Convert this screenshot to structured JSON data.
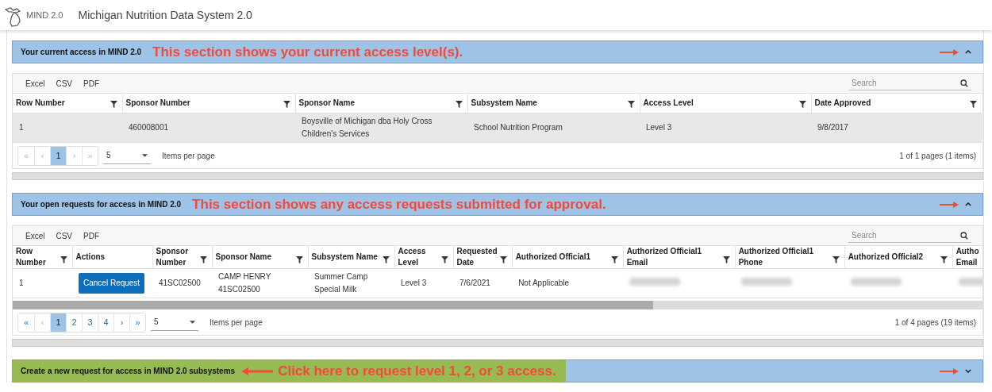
{
  "app": {
    "logo_text": "MIND 2.0",
    "title": "Michigan Nutrition Data System 2.0"
  },
  "panels": [
    {
      "kind": "grid",
      "title": "Your current access in MIND 2.0",
      "annotation": "This section shows your current access level(s).",
      "highlighted": false,
      "expanded": true,
      "grid": {
        "toolbar": [
          "Excel",
          "CSV",
          "PDF"
        ],
        "search": {
          "placeholder": "Search"
        },
        "scrollable": false,
        "columns": [
          {
            "label": "Row Number"
          },
          {
            "label": "Sponsor Number"
          },
          {
            "label": "Sponsor Name"
          },
          {
            "label": "Subsystem Name"
          },
          {
            "label": "Access Level"
          },
          {
            "label": "Date Approved"
          }
        ],
        "rows": [
          {
            "selected": true,
            "cells": [
              {
                "kind": "text",
                "text": "1"
              },
              {
                "kind": "text",
                "text": "460008001"
              },
              {
                "kind": "text",
                "text": "Boysville of Michigan dba Holy Cross Children's Services"
              },
              {
                "kind": "text",
                "text": "School Nutrition Program"
              },
              {
                "kind": "text",
                "text": "Level 3"
              },
              {
                "kind": "text",
                "text": "9/8/2017"
              }
            ]
          }
        ],
        "pager": {
          "first": "«",
          "prev": "‹",
          "next": "›",
          "last": "»",
          "nav_enabled": false,
          "pages": [
            {
              "label": "1",
              "selected": true
            }
          ],
          "page_size": "5",
          "page_size_label": "Items per page",
          "summary": "1 of 1 pages (1 items)"
        }
      }
    },
    {
      "kind": "grid",
      "title": "Your open requests for access in MIND 2.0",
      "annotation": "This section shows any access requests submitted for approval.",
      "highlighted": false,
      "expanded": true,
      "grid": {
        "toolbar": [
          "Excel",
          "CSV",
          "PDF"
        ],
        "search": {
          "placeholder": "Search"
        },
        "scrollable": true,
        "columns": [
          {
            "label": "Row Number",
            "filter": true
          },
          {
            "label": "Actions",
            "filter": false
          },
          {
            "label": "Sponsor Number",
            "filter": true
          },
          {
            "label": "Sponsor Name",
            "filter": true
          },
          {
            "label": "Subsystem Name",
            "filter": true
          },
          {
            "label": "Access Level",
            "filter": true
          },
          {
            "label": "Requested Date",
            "filter": true
          },
          {
            "label": "Authorized Official1",
            "filter": true
          },
          {
            "label": "Authorized Official1 Email",
            "filter": true
          },
          {
            "label": "Authorized Official1 Phone",
            "filter": true
          },
          {
            "label": "Authorized Official2",
            "filter": true
          },
          {
            "label": "Autho Email",
            "filter": false
          }
        ],
        "rows": [
          {
            "selected": false,
            "cells": [
              {
                "kind": "text",
                "text": "1"
              },
              {
                "kind": "button",
                "text": "Cancel Request"
              },
              {
                "kind": "text",
                "text": "41SC02500"
              },
              {
                "kind": "text",
                "text": "CAMP HENRY 41SC02500"
              },
              {
                "kind": "text",
                "text": "Summer Camp Special Milk"
              },
              {
                "kind": "text",
                "text": "Level 3"
              },
              {
                "kind": "text",
                "text": "7/6/2021"
              },
              {
                "kind": "text",
                "text": "Not Applicable"
              },
              {
                "kind": "redacted"
              },
              {
                "kind": "redacted"
              },
              {
                "kind": "redacted"
              },
              {
                "kind": "redacted"
              }
            ]
          }
        ],
        "pager": {
          "first": "«",
          "prev": "‹",
          "next": "›",
          "last": "»",
          "nav_enabled": true,
          "pages": [
            {
              "label": "1",
              "selected": true
            },
            {
              "label": "2",
              "selected": false
            },
            {
              "label": "3",
              "selected": false
            },
            {
              "label": "4",
              "selected": false
            }
          ],
          "page_size": "5",
          "page_size_label": "Items per page",
          "summary": "1 of 4 pages (19 items)"
        }
      }
    },
    {
      "kind": "cta",
      "title": "Create a new request for access in MIND 2.0 subsystems",
      "annotation": "Click here to request level 1, 2, or 3 access.",
      "highlighted": true,
      "expanded": false
    }
  ]
}
